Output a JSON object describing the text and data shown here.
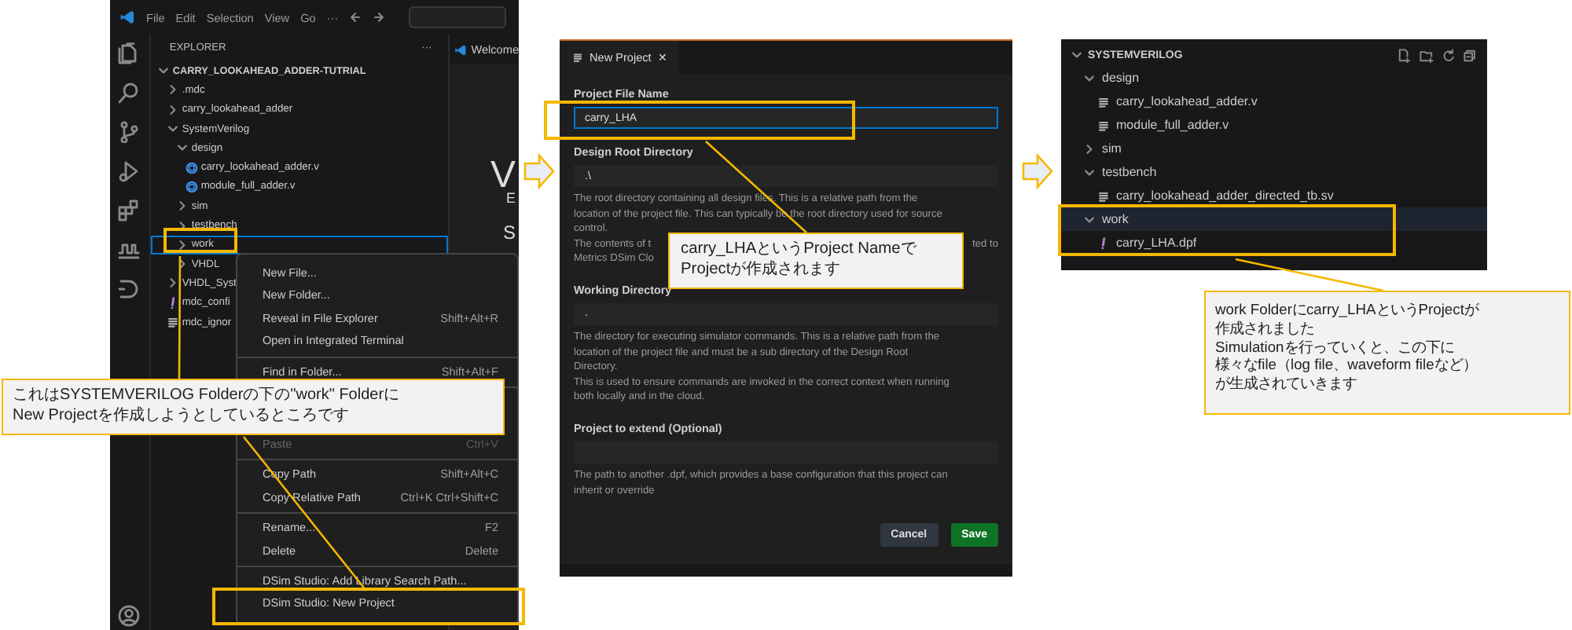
{
  "ide": {
    "menu": [
      "File",
      "Edit",
      "Selection",
      "View",
      "Go",
      "···"
    ],
    "editor_tab": "Welcome",
    "editor_fragments": [
      "V",
      "E",
      "S"
    ],
    "explorer": {
      "title": "EXPLORER",
      "more": "···",
      "tree": [
        {
          "label": "CARRY_LOOKAHEAD_ADDER-TUTRIAL",
          "kind": "root",
          "expanded": true,
          "selected": false,
          "children": [
            {
              "label": ".mdc",
              "kind": "folder",
              "expanded": false,
              "selected": false
            },
            {
              "label": "carry_lookahead_adder",
              "kind": "folder",
              "expanded": false,
              "selected": false
            },
            {
              "label": "SystemVerilog",
              "kind": "folder",
              "expanded": true,
              "selected": false,
              "children": [
                {
                  "label": "design",
                  "kind": "folder",
                  "expanded": true,
                  "selected": false,
                  "children": [
                    {
                      "label": "carry_lookahead_adder.v",
                      "kind": "verilog",
                      "selected": false
                    },
                    {
                      "label": "module_full_adder.v",
                      "kind": "verilog",
                      "selected": false
                    }
                  ]
                },
                {
                  "label": "sim",
                  "kind": "folder",
                  "expanded": false,
                  "selected": false
                },
                {
                  "label": "testbench",
                  "kind": "folder",
                  "expanded": false,
                  "selected": false
                },
                {
                  "label": "work",
                  "kind": "folder",
                  "expanded": false,
                  "selected": true
                },
                {
                  "label": "VHDL",
                  "kind": "folder",
                  "expanded": false,
                  "selected": false
                }
              ]
            },
            {
              "label": "VHDL_Syst",
              "kind": "folder",
              "expanded": false,
              "selected": false
            },
            {
              "label": "mdc_confi",
              "kind": "config",
              "selected": false
            },
            {
              "label": "mdc_ignor",
              "kind": "text",
              "selected": false
            }
          ]
        }
      ]
    },
    "context_menu": [
      [
        {
          "label": "New File...",
          "disabled": false
        },
        {
          "label": "New Folder...",
          "disabled": false
        },
        {
          "label": "Reveal in File Explorer",
          "shortcut": "Shift+Alt+R",
          "disabled": false
        },
        {
          "label": "Open in Integrated Terminal",
          "disabled": false
        }
      ],
      [
        {
          "label": "Find in Folder...",
          "shortcut": "Shift+Alt+F",
          "disabled": false
        }
      ],
      [
        {
          "label": "Paste",
          "shortcut": "Ctrl+V",
          "disabled": true
        }
      ],
      [
        {
          "label": "Copy Path",
          "shortcut": "Shift+Alt+C",
          "disabled": false
        },
        {
          "label": "Copy Relative Path",
          "shortcut": "Ctrl+K Ctrl+Shift+C",
          "disabled": false
        }
      ],
      [
        {
          "label": "Rename...",
          "shortcut": "F2",
          "disabled": false
        },
        {
          "label": "Delete",
          "shortcut": "Delete",
          "disabled": false
        }
      ],
      [
        {
          "label": "DSim Studio: Add Library Search Path...",
          "disabled": false
        },
        {
          "label": "DSim Studio: New Project",
          "disabled": false
        }
      ]
    ]
  },
  "new_project": {
    "tab": {
      "label": "New Project",
      "close": "✕"
    },
    "fields": [
      {
        "label": "Project File Name",
        "value": "carry_LHA",
        "focused": true
      },
      {
        "label": "Design Root Directory",
        "value": ".\\",
        "focused": false,
        "description": [
          {
            "text": "The root directory containing all design files. This is a relative path from the"
          },
          {
            "text": "location of the project file. This can typically be the root directory used for source"
          },
          {
            "text": "control."
          },
          {
            "text": "The contents of t",
            "tail": "ted to"
          },
          {
            "text": "Metrics DSim Clo"
          }
        ]
      },
      {
        "label": "Working Directory",
        "value": ".",
        "focused": false,
        "description": [
          {
            "text": "The directory for executing simulator commands. This is a relative path from the"
          },
          {
            "text": "location of the project file and must be a sub directory of the Design Root"
          },
          {
            "text": "Directory."
          },
          {
            "text": "This is used to ensure commands are invoked in the correct context when running"
          },
          {
            "text": "both locally and in the cloud."
          }
        ]
      },
      {
        "label": "Project to extend (Optional)",
        "focused": false,
        "description": [
          {
            "text": "The path to another .dpf, which provides a base configuration that this project can"
          },
          {
            "text": "inherit or override"
          }
        ]
      }
    ],
    "buttons": [
      {
        "label": "Cancel",
        "kind": "secondary"
      },
      {
        "label": "Save",
        "kind": "primary"
      }
    ]
  },
  "result_explorer": {
    "title": "SYSTEMVERILOG",
    "expanded": true,
    "tree": [
      {
        "label": "design",
        "kind": "folder",
        "expanded": true,
        "selected": false,
        "children": [
          {
            "label": "carry_lookahead_adder.v",
            "kind": "text",
            "selected": false
          },
          {
            "label": "module_full_adder.v",
            "kind": "text",
            "selected": false
          }
        ]
      },
      {
        "label": "sim",
        "kind": "folder",
        "expanded": false,
        "selected": false
      },
      {
        "label": "testbench",
        "kind": "folder",
        "expanded": true,
        "selected": false,
        "children": [
          {
            "label": "carry_lookahead_adder_directed_tb.sv",
            "kind": "text",
            "selected": false
          }
        ]
      },
      {
        "label": "work",
        "kind": "folder",
        "expanded": true,
        "selected": true,
        "children": [
          {
            "label": "carry_LHA.dpf",
            "kind": "config",
            "selected": false
          }
        ]
      }
    ]
  },
  "callouts": [
    {
      "lines": [
        "これはSYSTEMVERILOG Folderの下の\"work\" Folderに",
        "New Projectを作成しようとしているところです"
      ]
    },
    {
      "lines": [
        "carry_LHAというProject Nameで",
        "Projectが作成されます"
      ]
    },
    {
      "lines": [
        "work Folderにcarry_LHAというProjectが",
        "作成されました",
        "Simulationを行っていくと、この下に",
        "様々なfile（log file、waveform fileなど）",
        "が生成されていきます"
      ]
    }
  ]
}
